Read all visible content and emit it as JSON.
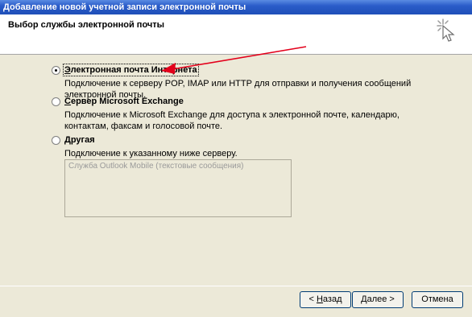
{
  "window": {
    "title": "Добавление новой учетной записи электронной почты"
  },
  "header": {
    "title": "Выбор службы электронной почты",
    "icon": "wizard-sparkle-icon"
  },
  "options": [
    {
      "label": "Электронная почта Интернета",
      "underline": "Э",
      "rest": "лектронная почта Интернета",
      "selected": true,
      "description": "Подключение к серверу POP, IMAP или HTTP для отправки и получения сообщений электронной почты."
    },
    {
      "label": "Сервер Microsoft Exchange",
      "underline": "С",
      "rest": "ервер Microsoft Exchange",
      "selected": false,
      "description": "Подключение к Microsoft Exchange для доступа к электронной почте, календарю, контактам, факсам и голосовой почте."
    },
    {
      "label": "Другая",
      "underline": "Д",
      "rest": "ругая",
      "selected": false,
      "description": "Подключение к указанному ниже серверу."
    }
  ],
  "other_servers_list": [
    "Служба Outlook Mobile (текстовые сообщения)"
  ],
  "buttons": {
    "back": "< Назад",
    "back_mnemonic_prefix": "< ",
    "back_underline": "Н",
    "back_rest": "азад",
    "next": "Далее >",
    "next_underline": "Д",
    "next_rest": "алее >",
    "cancel": "Отмена"
  },
  "annotation": {
    "arrow_color": "#e3001b"
  }
}
